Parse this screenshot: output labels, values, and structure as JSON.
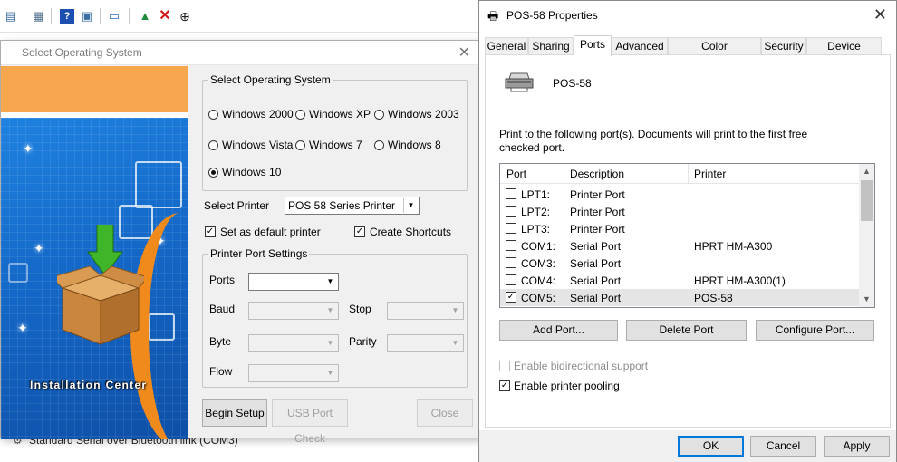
{
  "background": {
    "status_text": "Standard Serial over Bluetooth link (COM3)"
  },
  "installer": {
    "title": "Select Operating System",
    "banner_label": "Installation Center",
    "os_group_label": "Select Operating System",
    "os_options": [
      "Windows 2000",
      "Windows XP",
      "Windows 2003",
      "Windows Vista",
      "Windows 7",
      "Windows 8",
      "Windows 10"
    ],
    "os_selected": "Windows 10",
    "select_printer_label": "Select Printer",
    "printer_value": "POS 58 Series Printer",
    "default_printer_label": "Set as default printer",
    "default_printer_checked": true,
    "create_shortcuts_label": "Create Shortcuts",
    "create_shortcuts_checked": true,
    "port_group_label": "Printer Port Settings",
    "ports_label": "Ports",
    "baud_label": "Baud",
    "stop_label": "Stop",
    "byte_label": "Byte",
    "parity_label": "Parity",
    "flow_label": "Flow",
    "begin_setup": "Begin Setup",
    "usb_port_check": "USB Port Check",
    "close": "Close"
  },
  "properties": {
    "title": "POS-58 Properties",
    "tabs": [
      "General",
      "Sharing",
      "Ports",
      "Advanced",
      "Color Management",
      "Security",
      "Device Settings"
    ],
    "active_tab": "Ports",
    "printer_name": "POS-58",
    "description": "Print to the following port(s). Documents will print to the first free checked port.",
    "columns": [
      "Port",
      "Description",
      "Printer"
    ],
    "ports": [
      {
        "port": "LPT1:",
        "description": "Printer Port",
        "printer": "",
        "checked": false
      },
      {
        "port": "LPT2:",
        "description": "Printer Port",
        "printer": "",
        "checked": false
      },
      {
        "port": "LPT3:",
        "description": "Printer Port",
        "printer": "",
        "checked": false
      },
      {
        "port": "COM1:",
        "description": "Serial Port",
        "printer": "HPRT HM-A300",
        "checked": false
      },
      {
        "port": "COM3:",
        "description": "Serial Port",
        "printer": "",
        "checked": false
      },
      {
        "port": "COM4:",
        "description": "Serial Port",
        "printer": "HPRT HM-A300(1)",
        "checked": false
      },
      {
        "port": "COM5:",
        "description": "Serial Port",
        "printer": "POS-58",
        "checked": true
      }
    ],
    "add_port": "Add Port...",
    "delete_port": "Delete Port",
    "configure_port": "Configure Port...",
    "bidirectional_label": "Enable bidirectional support",
    "bidirectional_checked": false,
    "pooling_label": "Enable printer pooling",
    "pooling_checked": true,
    "ok": "OK",
    "cancel": "Cancel",
    "apply": "Apply"
  }
}
